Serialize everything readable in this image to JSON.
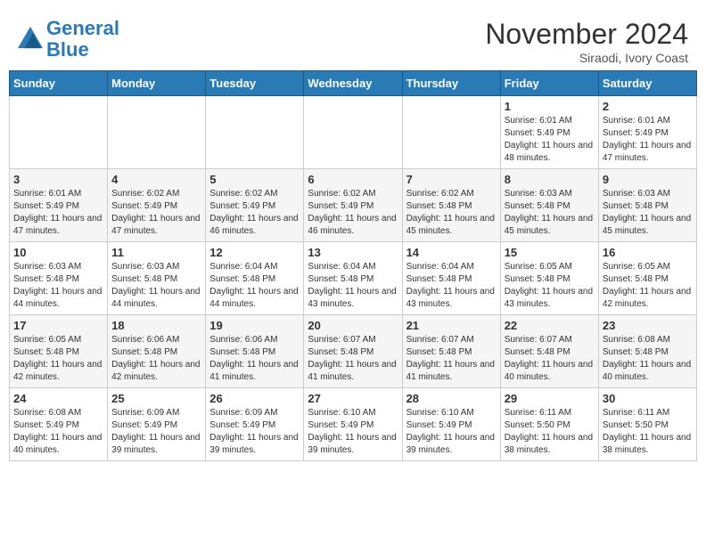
{
  "header": {
    "logo_line1": "General",
    "logo_line2": "Blue",
    "month": "November 2024",
    "location": "Siraodi, Ivory Coast"
  },
  "weekdays": [
    "Sunday",
    "Monday",
    "Tuesday",
    "Wednesday",
    "Thursday",
    "Friday",
    "Saturday"
  ],
  "weeks": [
    [
      {
        "day": "",
        "info": ""
      },
      {
        "day": "",
        "info": ""
      },
      {
        "day": "",
        "info": ""
      },
      {
        "day": "",
        "info": ""
      },
      {
        "day": "",
        "info": ""
      },
      {
        "day": "1",
        "info": "Sunrise: 6:01 AM\nSunset: 5:49 PM\nDaylight: 11 hours\nand 48 minutes."
      },
      {
        "day": "2",
        "info": "Sunrise: 6:01 AM\nSunset: 5:49 PM\nDaylight: 11 hours\nand 47 minutes."
      }
    ],
    [
      {
        "day": "3",
        "info": "Sunrise: 6:01 AM\nSunset: 5:49 PM\nDaylight: 11 hours\nand 47 minutes."
      },
      {
        "day": "4",
        "info": "Sunrise: 6:02 AM\nSunset: 5:49 PM\nDaylight: 11 hours\nand 47 minutes."
      },
      {
        "day": "5",
        "info": "Sunrise: 6:02 AM\nSunset: 5:49 PM\nDaylight: 11 hours\nand 46 minutes."
      },
      {
        "day": "6",
        "info": "Sunrise: 6:02 AM\nSunset: 5:49 PM\nDaylight: 11 hours\nand 46 minutes."
      },
      {
        "day": "7",
        "info": "Sunrise: 6:02 AM\nSunset: 5:48 PM\nDaylight: 11 hours\nand 45 minutes."
      },
      {
        "day": "8",
        "info": "Sunrise: 6:03 AM\nSunset: 5:48 PM\nDaylight: 11 hours\nand 45 minutes."
      },
      {
        "day": "9",
        "info": "Sunrise: 6:03 AM\nSunset: 5:48 PM\nDaylight: 11 hours\nand 45 minutes."
      }
    ],
    [
      {
        "day": "10",
        "info": "Sunrise: 6:03 AM\nSunset: 5:48 PM\nDaylight: 11 hours\nand 44 minutes."
      },
      {
        "day": "11",
        "info": "Sunrise: 6:03 AM\nSunset: 5:48 PM\nDaylight: 11 hours\nand 44 minutes."
      },
      {
        "day": "12",
        "info": "Sunrise: 6:04 AM\nSunset: 5:48 PM\nDaylight: 11 hours\nand 44 minutes."
      },
      {
        "day": "13",
        "info": "Sunrise: 6:04 AM\nSunset: 5:48 PM\nDaylight: 11 hours\nand 43 minutes."
      },
      {
        "day": "14",
        "info": "Sunrise: 6:04 AM\nSunset: 5:48 PM\nDaylight: 11 hours\nand 43 minutes."
      },
      {
        "day": "15",
        "info": "Sunrise: 6:05 AM\nSunset: 5:48 PM\nDaylight: 11 hours\nand 43 minutes."
      },
      {
        "day": "16",
        "info": "Sunrise: 6:05 AM\nSunset: 5:48 PM\nDaylight: 11 hours\nand 42 minutes."
      }
    ],
    [
      {
        "day": "17",
        "info": "Sunrise: 6:05 AM\nSunset: 5:48 PM\nDaylight: 11 hours\nand 42 minutes."
      },
      {
        "day": "18",
        "info": "Sunrise: 6:06 AM\nSunset: 5:48 PM\nDaylight: 11 hours\nand 42 minutes."
      },
      {
        "day": "19",
        "info": "Sunrise: 6:06 AM\nSunset: 5:48 PM\nDaylight: 11 hours\nand 41 minutes."
      },
      {
        "day": "20",
        "info": "Sunrise: 6:07 AM\nSunset: 5:48 PM\nDaylight: 11 hours\nand 41 minutes."
      },
      {
        "day": "21",
        "info": "Sunrise: 6:07 AM\nSunset: 5:48 PM\nDaylight: 11 hours\nand 41 minutes."
      },
      {
        "day": "22",
        "info": "Sunrise: 6:07 AM\nSunset: 5:48 PM\nDaylight: 11 hours\nand 40 minutes."
      },
      {
        "day": "23",
        "info": "Sunrise: 6:08 AM\nSunset: 5:48 PM\nDaylight: 11 hours\nand 40 minutes."
      }
    ],
    [
      {
        "day": "24",
        "info": "Sunrise: 6:08 AM\nSunset: 5:49 PM\nDaylight: 11 hours\nand 40 minutes."
      },
      {
        "day": "25",
        "info": "Sunrise: 6:09 AM\nSunset: 5:49 PM\nDaylight: 11 hours\nand 39 minutes."
      },
      {
        "day": "26",
        "info": "Sunrise: 6:09 AM\nSunset: 5:49 PM\nDaylight: 11 hours\nand 39 minutes."
      },
      {
        "day": "27",
        "info": "Sunrise: 6:10 AM\nSunset: 5:49 PM\nDaylight: 11 hours\nand 39 minutes."
      },
      {
        "day": "28",
        "info": "Sunrise: 6:10 AM\nSunset: 5:49 PM\nDaylight: 11 hours\nand 39 minutes."
      },
      {
        "day": "29",
        "info": "Sunrise: 6:11 AM\nSunset: 5:50 PM\nDaylight: 11 hours\nand 38 minutes."
      },
      {
        "day": "30",
        "info": "Sunrise: 6:11 AM\nSunset: 5:50 PM\nDaylight: 11 hours\nand 38 minutes."
      }
    ]
  ]
}
